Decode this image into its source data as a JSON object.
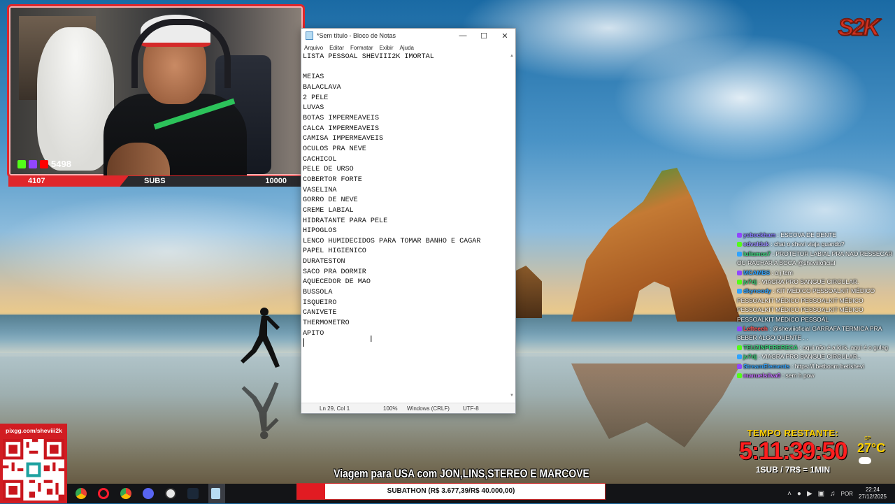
{
  "stream": {
    "viewer_count": "5498",
    "subs_current": "4107",
    "subs_label": "SUBS",
    "subs_goal": "10000",
    "subs_progress_fraction": 0.41,
    "logo_text": "S2K",
    "qr_url": "pixgg.com/sheviii2k",
    "marquee": "Viagem para USA com JON,LINS,STEREO E MARCOVE",
    "subathon": "SUBATHON (R$ 3.677,39/R$ 40.000,00)",
    "subathon_progress_fraction": 0.092,
    "timer_label": "TEMPO RESTANTE:",
    "timer": "5:11:39:50",
    "rate": "1SUB / 7R$ = 1MIN",
    "weather_loc": "SP",
    "weather_temp": "27°C"
  },
  "notepad": {
    "title": "*Sem título - Bloco de Notas",
    "menu": [
      "Arquivo",
      "Editar",
      "Formatar",
      "Exibir",
      "Ajuda"
    ],
    "minimize_icon": "minimize-icon",
    "maximize_icon": "maximize-icon",
    "close_icon": "close-icon",
    "content": "LISTA PESSOAL SHEVIII2K IMORTAL\n\nMEIAS\nBALACLAVA\n2 PELE\nLUVAS\nBOTAS IMPERMEAVEIS\nCALCA IMPERMEAVEIS\nCAMISA IMPERMEAVEIS\nOCULOS PRA NEVE\nCACHICOL\nPELE DE URSO\nCOBERTOR FORTE\nVASELINA\nGORRO DE NEVE\nCREME LABIAL\nHIDRATANTE PARA PELE\nHIPOGLOS\nLENCO HUMIDECIDOS PARA TOMAR BANHO E CAGAR\nPAPEL HIGIENICO\nDURATESTON\nSACO PRA DORMIR\nAQUECEDOR DE MAO\nBUSSOLA\nISQUEIRO\nCANIVETE\nTHERMOMETRO\nAPITO\n",
    "status": {
      "position": "Ln 29, Col 1",
      "zoom": "100%",
      "line_ending": "Windows (CRLF)",
      "encoding": "UTF-8"
    }
  },
  "chat": [
    {
      "user": "ysbeckham",
      "text": ": ESCOVA DE DENTE",
      "color": "#8a7cff"
    },
    {
      "user": "edvalduk",
      "text": ": chat o shevi viaja quando?",
      "color": "#9b8cff"
    },
    {
      "user": "luliamos7",
      "text": ": PROTETOR LABIAL PRA NAO RESSECAR OU RACHAR A BOCA @sheviiioficial",
      "color": "#37d67a"
    },
    {
      "user": "MCAMBS",
      "text": ": a j tem",
      "color": "#2fa3ff"
    },
    {
      "user": "jv7dj",
      "text": ": VIAGRA PRO SANGUE CIRCULAR.",
      "color": "#37d67a"
    },
    {
      "user": "dkynoody",
      "text": ": KIT MÉDICO PESSOALKIT MÉDICO PESSOALKIT MÉDICO PESSOALKIT MÉDICO PESSOALKIT MÉDICO PESSOALKIT MÉDICO PESSOALKIT MÉDICO PESSOAL",
      "color": "#2fa3ff"
    },
    {
      "user": "Lefteeeh",
      "text": ": @sheviiioficial GARRAFA TERMICA PRA BEBER ALGO QUENTE . .",
      "color": "#ff5555"
    },
    {
      "user": "TEUZINPERERECA",
      "text": ": aqui não é a kick, aqui é o gulag",
      "color": "#37d67a"
    },
    {
      "user": "jv7dj",
      "text": ": VIAGRA PRO SANGUE CIRCULAR..",
      "color": "#37d67a"
    },
    {
      "user": "StreamElements",
      "text": ": https://l.betboom.bet/shevi",
      "color": "#2fa3ff"
    },
    {
      "user": "manuelsilva0",
      "text": ": sem h pow",
      "color": "#c46bff"
    }
  ],
  "taskbar": {
    "apps": [
      "chrome-icon",
      "opera-icon",
      "chrome-icon-2",
      "discord-icon",
      "obs-icon",
      "steam-icon",
      "notepad-icon"
    ],
    "language": "POR",
    "time": "22:24",
    "date": "27/12/2025"
  },
  "colors": {
    "accent_red": "#e0262b",
    "timer_red": "#ff1f1f",
    "timer_label_yellow": "#ffd200"
  }
}
